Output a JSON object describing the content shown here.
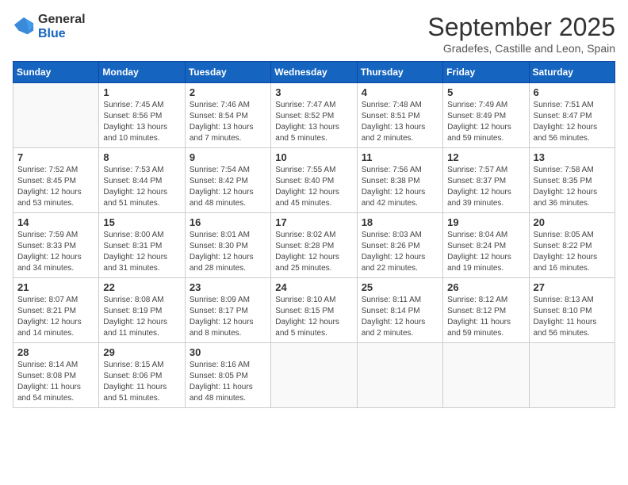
{
  "logo": {
    "general": "General",
    "blue": "Blue"
  },
  "title": "September 2025",
  "location": "Gradefes, Castille and Leon, Spain",
  "days_of_week": [
    "Sunday",
    "Monday",
    "Tuesday",
    "Wednesday",
    "Thursday",
    "Friday",
    "Saturday"
  ],
  "weeks": [
    [
      {
        "day": "",
        "sunrise": "",
        "sunset": "",
        "daylight": ""
      },
      {
        "day": "1",
        "sunrise": "Sunrise: 7:45 AM",
        "sunset": "Sunset: 8:56 PM",
        "daylight": "Daylight: 13 hours and 10 minutes."
      },
      {
        "day": "2",
        "sunrise": "Sunrise: 7:46 AM",
        "sunset": "Sunset: 8:54 PM",
        "daylight": "Daylight: 13 hours and 7 minutes."
      },
      {
        "day": "3",
        "sunrise": "Sunrise: 7:47 AM",
        "sunset": "Sunset: 8:52 PM",
        "daylight": "Daylight: 13 hours and 5 minutes."
      },
      {
        "day": "4",
        "sunrise": "Sunrise: 7:48 AM",
        "sunset": "Sunset: 8:51 PM",
        "daylight": "Daylight: 13 hours and 2 minutes."
      },
      {
        "day": "5",
        "sunrise": "Sunrise: 7:49 AM",
        "sunset": "Sunset: 8:49 PM",
        "daylight": "Daylight: 12 hours and 59 minutes."
      },
      {
        "day": "6",
        "sunrise": "Sunrise: 7:51 AM",
        "sunset": "Sunset: 8:47 PM",
        "daylight": "Daylight: 12 hours and 56 minutes."
      }
    ],
    [
      {
        "day": "7",
        "sunrise": "Sunrise: 7:52 AM",
        "sunset": "Sunset: 8:45 PM",
        "daylight": "Daylight: 12 hours and 53 minutes."
      },
      {
        "day": "8",
        "sunrise": "Sunrise: 7:53 AM",
        "sunset": "Sunset: 8:44 PM",
        "daylight": "Daylight: 12 hours and 51 minutes."
      },
      {
        "day": "9",
        "sunrise": "Sunrise: 7:54 AM",
        "sunset": "Sunset: 8:42 PM",
        "daylight": "Daylight: 12 hours and 48 minutes."
      },
      {
        "day": "10",
        "sunrise": "Sunrise: 7:55 AM",
        "sunset": "Sunset: 8:40 PM",
        "daylight": "Daylight: 12 hours and 45 minutes."
      },
      {
        "day": "11",
        "sunrise": "Sunrise: 7:56 AM",
        "sunset": "Sunset: 8:38 PM",
        "daylight": "Daylight: 12 hours and 42 minutes."
      },
      {
        "day": "12",
        "sunrise": "Sunrise: 7:57 AM",
        "sunset": "Sunset: 8:37 PM",
        "daylight": "Daylight: 12 hours and 39 minutes."
      },
      {
        "day": "13",
        "sunrise": "Sunrise: 7:58 AM",
        "sunset": "Sunset: 8:35 PM",
        "daylight": "Daylight: 12 hours and 36 minutes."
      }
    ],
    [
      {
        "day": "14",
        "sunrise": "Sunrise: 7:59 AM",
        "sunset": "Sunset: 8:33 PM",
        "daylight": "Daylight: 12 hours and 34 minutes."
      },
      {
        "day": "15",
        "sunrise": "Sunrise: 8:00 AM",
        "sunset": "Sunset: 8:31 PM",
        "daylight": "Daylight: 12 hours and 31 minutes."
      },
      {
        "day": "16",
        "sunrise": "Sunrise: 8:01 AM",
        "sunset": "Sunset: 8:30 PM",
        "daylight": "Daylight: 12 hours and 28 minutes."
      },
      {
        "day": "17",
        "sunrise": "Sunrise: 8:02 AM",
        "sunset": "Sunset: 8:28 PM",
        "daylight": "Daylight: 12 hours and 25 minutes."
      },
      {
        "day": "18",
        "sunrise": "Sunrise: 8:03 AM",
        "sunset": "Sunset: 8:26 PM",
        "daylight": "Daylight: 12 hours and 22 minutes."
      },
      {
        "day": "19",
        "sunrise": "Sunrise: 8:04 AM",
        "sunset": "Sunset: 8:24 PM",
        "daylight": "Daylight: 12 hours and 19 minutes."
      },
      {
        "day": "20",
        "sunrise": "Sunrise: 8:05 AM",
        "sunset": "Sunset: 8:22 PM",
        "daylight": "Daylight: 12 hours and 16 minutes."
      }
    ],
    [
      {
        "day": "21",
        "sunrise": "Sunrise: 8:07 AM",
        "sunset": "Sunset: 8:21 PM",
        "daylight": "Daylight: 12 hours and 14 minutes."
      },
      {
        "day": "22",
        "sunrise": "Sunrise: 8:08 AM",
        "sunset": "Sunset: 8:19 PM",
        "daylight": "Daylight: 12 hours and 11 minutes."
      },
      {
        "day": "23",
        "sunrise": "Sunrise: 8:09 AM",
        "sunset": "Sunset: 8:17 PM",
        "daylight": "Daylight: 12 hours and 8 minutes."
      },
      {
        "day": "24",
        "sunrise": "Sunrise: 8:10 AM",
        "sunset": "Sunset: 8:15 PM",
        "daylight": "Daylight: 12 hours and 5 minutes."
      },
      {
        "day": "25",
        "sunrise": "Sunrise: 8:11 AM",
        "sunset": "Sunset: 8:14 PM",
        "daylight": "Daylight: 12 hours and 2 minutes."
      },
      {
        "day": "26",
        "sunrise": "Sunrise: 8:12 AM",
        "sunset": "Sunset: 8:12 PM",
        "daylight": "Daylight: 11 hours and 59 minutes."
      },
      {
        "day": "27",
        "sunrise": "Sunrise: 8:13 AM",
        "sunset": "Sunset: 8:10 PM",
        "daylight": "Daylight: 11 hours and 56 minutes."
      }
    ],
    [
      {
        "day": "28",
        "sunrise": "Sunrise: 8:14 AM",
        "sunset": "Sunset: 8:08 PM",
        "daylight": "Daylight: 11 hours and 54 minutes."
      },
      {
        "day": "29",
        "sunrise": "Sunrise: 8:15 AM",
        "sunset": "Sunset: 8:06 PM",
        "daylight": "Daylight: 11 hours and 51 minutes."
      },
      {
        "day": "30",
        "sunrise": "Sunrise: 8:16 AM",
        "sunset": "Sunset: 8:05 PM",
        "daylight": "Daylight: 11 hours and 48 minutes."
      },
      {
        "day": "",
        "sunrise": "",
        "sunset": "",
        "daylight": ""
      },
      {
        "day": "",
        "sunrise": "",
        "sunset": "",
        "daylight": ""
      },
      {
        "day": "",
        "sunrise": "",
        "sunset": "",
        "daylight": ""
      },
      {
        "day": "",
        "sunrise": "",
        "sunset": "",
        "daylight": ""
      }
    ]
  ]
}
